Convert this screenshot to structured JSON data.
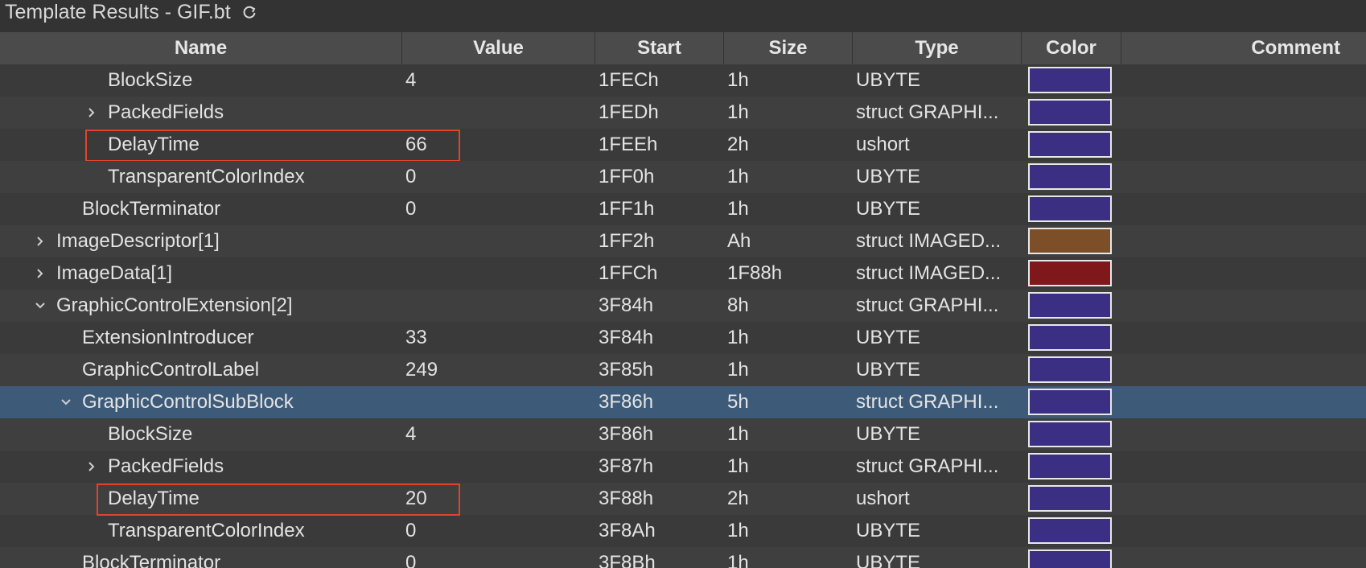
{
  "window": {
    "title": "Template Results - GIF.bt",
    "refresh_icon": "refresh-icon"
  },
  "columns": [
    "Name",
    "Value",
    "Start",
    "Size",
    "Type",
    "Color",
    "Comment"
  ],
  "colors": {
    "purple": "#3b2f83",
    "brown": "#7c4f28",
    "red": "#7f181b",
    "selection": "#3d5b79",
    "highlight_border": "#e0442c"
  },
  "rows": [
    {
      "indent": 3,
      "expander": "none",
      "name": "BlockSize",
      "value": "4",
      "start": "1FECh",
      "size": "1h",
      "type": "UBYTE",
      "color": "purple"
    },
    {
      "indent": 3,
      "expander": "collapsed",
      "name": "PackedFields",
      "value": "",
      "start": "1FEDh",
      "size": "1h",
      "type": "struct GRAPHI...",
      "color": "purple"
    },
    {
      "indent": 3,
      "expander": "none",
      "name": "DelayTime",
      "value": "66",
      "start": "1FEEh",
      "size": "2h",
      "type": "ushort",
      "color": "purple",
      "highlight": true
    },
    {
      "indent": 3,
      "expander": "none",
      "name": "TransparentColorIndex",
      "value": "0",
      "start": "1FF0h",
      "size": "1h",
      "type": "UBYTE",
      "color": "purple"
    },
    {
      "indent": 2,
      "expander": "none",
      "name": "BlockTerminator",
      "value": "0",
      "start": "1FF1h",
      "size": "1h",
      "type": "UBYTE",
      "color": "purple"
    },
    {
      "indent": 1,
      "expander": "collapsed",
      "name": "ImageDescriptor[1]",
      "value": "",
      "start": "1FF2h",
      "size": "Ah",
      "type": "struct IMAGED...",
      "color": "brown"
    },
    {
      "indent": 1,
      "expander": "collapsed",
      "name": "ImageData[1]",
      "value": "",
      "start": "1FFCh",
      "size": "1F88h",
      "type": "struct IMAGED...",
      "color": "red"
    },
    {
      "indent": 1,
      "expander": "expanded",
      "name": "GraphicControlExtension[2]",
      "value": "",
      "start": "3F84h",
      "size": "8h",
      "type": "struct GRAPHI...",
      "color": "purple"
    },
    {
      "indent": 2,
      "expander": "none",
      "name": "ExtensionIntroducer",
      "value": "33",
      "start": "3F84h",
      "size": "1h",
      "type": "UBYTE",
      "color": "purple"
    },
    {
      "indent": 2,
      "expander": "none",
      "name": "GraphicControlLabel",
      "value": "249",
      "start": "3F85h",
      "size": "1h",
      "type": "UBYTE",
      "color": "purple"
    },
    {
      "indent": 2,
      "expander": "expanded",
      "name": "GraphicControlSubBlock",
      "value": "",
      "start": "3F86h",
      "size": "5h",
      "type": "struct GRAPHI...",
      "color": "purple",
      "selected": true
    },
    {
      "indent": 3,
      "expander": "none",
      "name": "BlockSize",
      "value": "4",
      "start": "3F86h",
      "size": "1h",
      "type": "UBYTE",
      "color": "purple"
    },
    {
      "indent": 3,
      "expander": "collapsed",
      "name": "PackedFields",
      "value": "",
      "start": "3F87h",
      "size": "1h",
      "type": "struct GRAPHI...",
      "color": "purple"
    },
    {
      "indent": 3,
      "expander": "none",
      "name": "DelayTime",
      "value": "20",
      "start": "3F88h",
      "size": "2h",
      "type": "ushort",
      "color": "purple",
      "highlight": true
    },
    {
      "indent": 3,
      "expander": "none",
      "name": "TransparentColorIndex",
      "value": "0",
      "start": "3F8Ah",
      "size": "1h",
      "type": "UBYTE",
      "color": "purple"
    },
    {
      "indent": 2,
      "expander": "none",
      "name": "BlockTerminator",
      "value": "0",
      "start": "3F8Bh",
      "size": "1h",
      "type": "UBYTE",
      "color": "purple"
    }
  ]
}
